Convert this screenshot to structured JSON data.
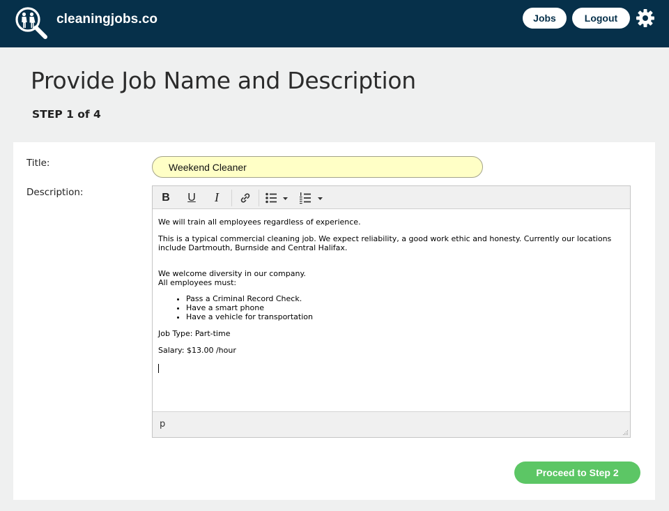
{
  "header": {
    "brand": "cleaningjobs.co",
    "logo_icon": "people-magnifier-icon",
    "nav": {
      "jobs_label": "Jobs",
      "logout_label": "Logout"
    },
    "settings_icon": "gear-icon"
  },
  "page": {
    "title": "Provide Job Name and Description",
    "step": "STEP 1 of 4"
  },
  "form": {
    "title_label": "Title:",
    "title_value": "Weekend Cleaner",
    "description_label": "Description:",
    "editor": {
      "toolbar": {
        "bold_label": "B",
        "underline_label": "U",
        "italic_label": "I",
        "link_icon": "link-icon",
        "bullet_list_icon": "bullet-list-icon",
        "numbered_list_icon": "numbered-list-icon"
      },
      "content": {
        "p1": "We will train all employees regardless of experience.",
        "p2": "This is a typical commercial cleaning job. We expect reliability, a good work ethic and honesty. Currently our locations include Dartmouth, Burnside and Central Halifax.",
        "p3a": "We welcome diversity in our company.",
        "p3b": "All employees must:",
        "requirements": [
          "Pass a Criminal Record Check.",
          "Have a smart phone",
          "Have a vehicle for transportation"
        ],
        "job_type": "Job Type: Part-time",
        "salary": "Salary: $13.00 /hour"
      },
      "status_path": "p"
    },
    "proceed_label": "Proceed to Step 2"
  },
  "colors": {
    "header_bg": "#06304a",
    "page_bg": "#eff0f0",
    "input_bg": "#ffffc6",
    "proceed_bg": "#5cc665"
  }
}
